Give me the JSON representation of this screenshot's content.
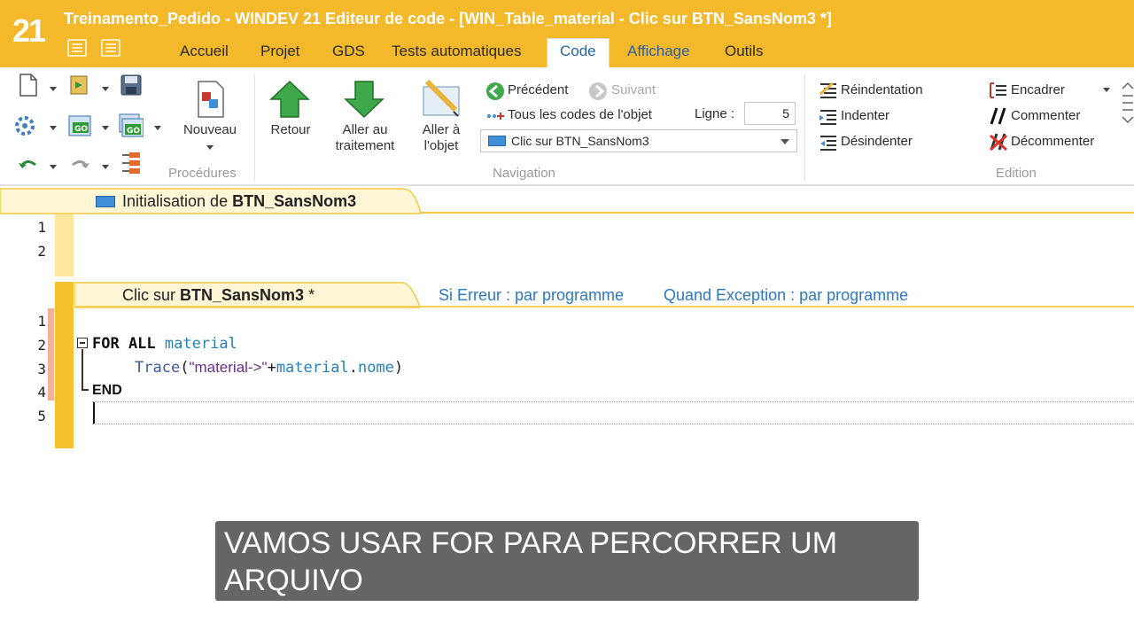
{
  "app": {
    "logo": "21",
    "title": "Treinamento_Pedido - WINDEV 21  Editeur de code - [WIN_Table_material - Clic sur BTN_SansNom3 *]"
  },
  "tabs": [
    {
      "label": "Accueil"
    },
    {
      "label": "Projet"
    },
    {
      "label": "GDS"
    },
    {
      "label": "Tests automatiques"
    },
    {
      "label": "Code"
    },
    {
      "label": "Affichage"
    },
    {
      "label": "Outils"
    }
  ],
  "ribbon": {
    "procedures": {
      "new_label": "Nouveau",
      "group_label": "Procédures"
    },
    "navigation": {
      "retour": "Retour",
      "aller_traitement": "Aller au\ntraitement",
      "aller_objet": "Aller à\nl'objet",
      "precedent": "Précédent",
      "suivant": "Suivant",
      "tous_codes": "Tous les codes de l'objet",
      "ligne_label": "Ligne :",
      "ligne_value": "5",
      "combo_value": "Clic sur BTN_SansNom3",
      "group_label": "Navigation"
    },
    "edition": {
      "reindentation": "Réindentation",
      "indenter": "Indenter",
      "desindenter": "Désindenter",
      "encadrer": "Encadrer",
      "commenter": "Commenter",
      "decommenter": "Décommenter",
      "group_label": "Edition"
    }
  },
  "editor": {
    "section1": {
      "title_prefix": "Initialisation de ",
      "title_bold": "BTN_SansNom3",
      "lines": [
        "1",
        "2"
      ]
    },
    "section2": {
      "title_prefix": "Clic sur ",
      "title_bold": "BTN_SansNom3",
      "title_suffix": " *",
      "opt_erreur": "Si Erreur : par programme",
      "opt_exception": "Quand Exception : par programme",
      "lines": [
        "1",
        "2",
        "3",
        "4",
        "5"
      ],
      "code": {
        "for_kw": "FOR ALL",
        "for_var": "material",
        "trace_fn": "Trace",
        "trace_open": "(",
        "trace_str": "\"material->\"",
        "trace_plus": "+",
        "trace_obj": "material",
        "trace_dot": ".",
        "trace_field": "nome",
        "trace_close": ")",
        "end_kw": "END"
      }
    }
  },
  "subtitle": "VAMOS USAR FOR PARA PERCORRER UM ARQUIVO",
  "colors": {
    "titlebar": "#f3b92a",
    "keyword": "#111111",
    "variable": "#2a7fb5",
    "string": "#6b2d8c",
    "options_link": "#2e78c0"
  }
}
